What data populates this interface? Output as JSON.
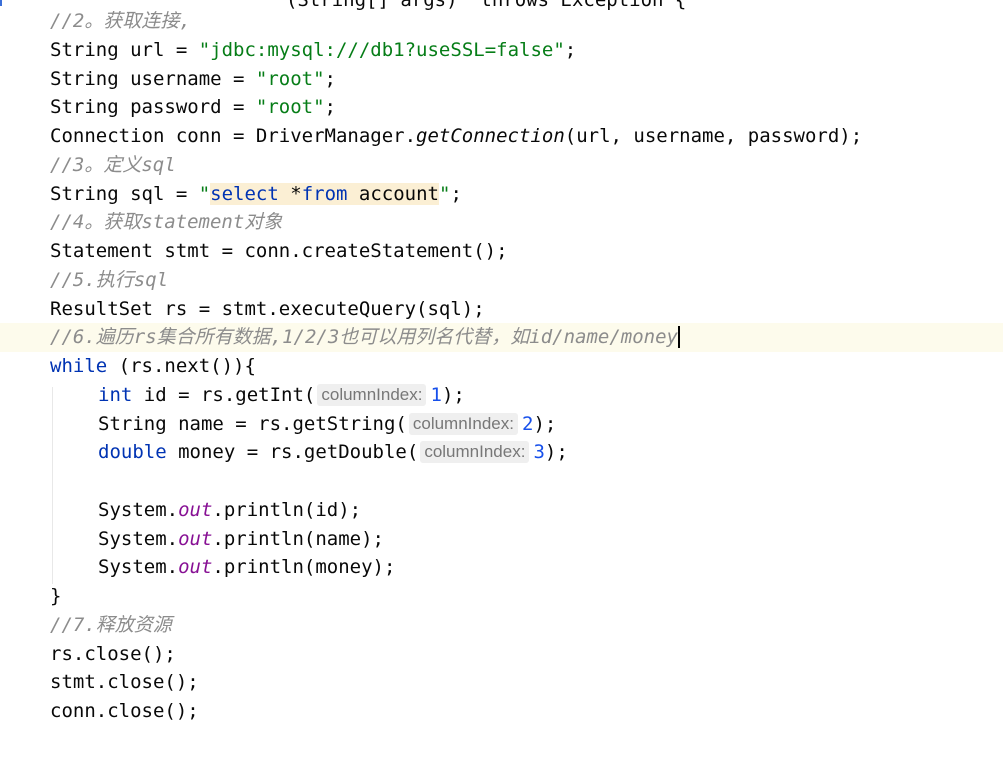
{
  "code": {
    "top_cut": "                         (String[] args)  throws Exception {",
    "l1_comment": "//2。获取连接,",
    "l2_a": "String url = ",
    "l2_str": "\"jdbc:mysql:///db1?useSSL=false\"",
    "l2_end": ";",
    "l3_a": "String username = ",
    "l3_str": "\"root\"",
    "l3_end": ";",
    "l4_a": "String password = ",
    "l4_str": "\"root\"",
    "l4_end": ";",
    "l5_a": "Connection conn = DriverManager.",
    "l5_m": "getConnection",
    "l5_b": "(url, username, password);",
    "l6_comment": "//3。定义sql",
    "l7_a": "String sql = ",
    "l7_q1": "\"",
    "l7_kw1": "select",
    "l7_sp": " *",
    "l7_kw2": "from",
    "l7_tbl": " account",
    "l7_q2": "\"",
    "l7_end": ";",
    "l8_comment": "//4。获取statement对象",
    "l9": "Statement stmt = conn.createStatement();",
    "l10_comment": "//5.执行sql",
    "l11": "ResultSet rs = stmt.executeQuery(sql);",
    "l12_comment": "//6.遍历rs集合所有数据,1/2/3也可以用列名代替，如id/name/money",
    "l13_kw": "while",
    "l13_b": " (rs.next()){",
    "l14_kw": "int",
    "l14_b": " id = rs.getInt(",
    "l14_hint": "columnIndex:",
    "l14_num": "1",
    "l14_end": ");",
    "l15_a": "String name = rs.getString(",
    "l15_hint": "columnIndex:",
    "l15_num": "2",
    "l15_end": ");",
    "l16_kw": "double",
    "l16_b": " money = rs.getDouble(",
    "l16_hint": "columnIndex:",
    "l16_num": "3",
    "l16_end": ");",
    "sys": "System.",
    "out": "out",
    "l18_b": ".println(id);",
    "l19_b": ".println(name);",
    "l20_b": ".println(money);",
    "l21": "}",
    "l22_comment": "//7.释放资源",
    "l23": "rs.close();",
    "l24": "stmt.close();",
    "l25": "conn.close();"
  },
  "colors": {
    "keyword": "#0033b3",
    "string": "#067d17",
    "comment": "#8c8c8c",
    "field": "#871094",
    "number": "#1750eb",
    "current_line": "#fdfbec"
  }
}
